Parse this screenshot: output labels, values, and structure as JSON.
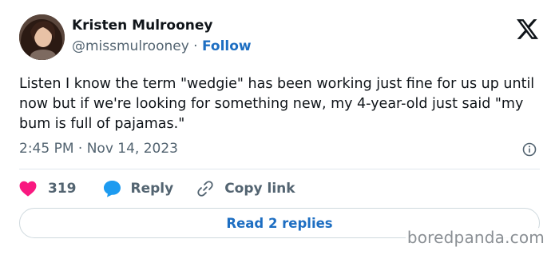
{
  "author": {
    "name": "Kristen Mulrooney",
    "handle": "@missmulrooney",
    "separator": " · ",
    "follow_label": "Follow"
  },
  "tweet": {
    "text": "Listen I know the term \"wedgie\" has been working just fine for us up until now but if we're looking for something new, my 4-year-old just said \"my bum is full of pajamas.\"",
    "timestamp": "2:45 PM · Nov 14, 2023"
  },
  "actions": {
    "like_count": "319",
    "reply_label": "Reply",
    "copy_link_label": "Copy link"
  },
  "read_replies_label": "Read 2 replies",
  "watermark": "boredpanda.com",
  "icons": {
    "platform": "x-logo-icon",
    "info": "info-icon",
    "like": "heart-icon",
    "reply": "speech-bubble-icon",
    "copy": "link-icon"
  },
  "colors": {
    "like": "#f91880",
    "reply": "#1d9bf0",
    "link": "#1d6ec2",
    "text": "#0f1419",
    "secondary": "#536471"
  }
}
